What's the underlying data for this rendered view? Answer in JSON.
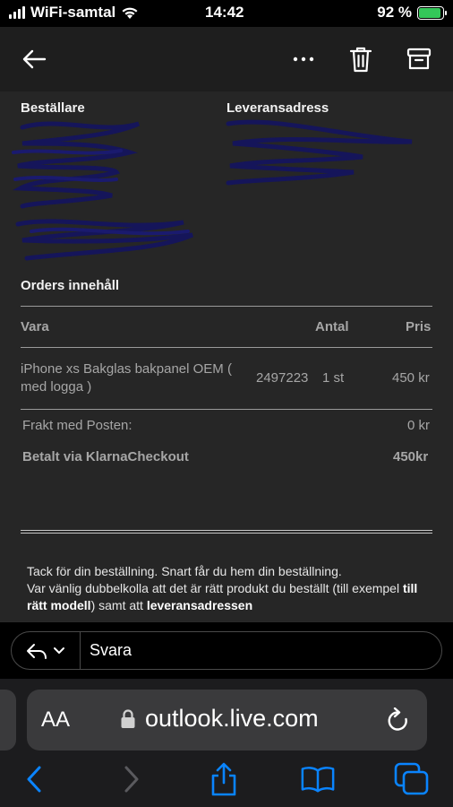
{
  "status_bar": {
    "carrier": "WiFi-samtal",
    "time": "14:42",
    "battery_percent": "92 %",
    "battery_level": 0.92,
    "battery_color": "#34c759"
  },
  "toolbar": {
    "back_icon": "arrow-left-icon",
    "more_icon": "more-dots-icon",
    "delete_icon": "trash-icon",
    "archive_icon": "archive-icon"
  },
  "email": {
    "buyer_heading": "Beställare",
    "delivery_heading": "Leveransadress",
    "order_contents_title": "Orders innehåll",
    "table": {
      "headers": {
        "item": "Vara",
        "quantity": "Antal",
        "price": "Pris"
      },
      "rows": [
        {
          "item": "iPhone xs Bakglas bakpanel OEM ( med logga )",
          "sku": "2497223",
          "quantity": "1 st",
          "price": "450 kr"
        }
      ]
    },
    "shipping_label": "Frakt med Posten:",
    "shipping_value": "0 kr",
    "paid_label": "Betalt via KlarnaCheckout",
    "paid_value": "450kr",
    "footer_line1": "Tack för din beställning. Snart får du hem din beställning.",
    "footer_line2_start": "Var vänlig dubbelkolla att det är rätt produkt du beställt (till exempel ",
    "footer_bold1": "till rätt modell",
    "footer_mid": ") samt att ",
    "footer_bold2": "leveransadressen"
  },
  "reply": {
    "action_icon": "reply-icon",
    "placeholder": "Svara"
  },
  "safari": {
    "text_size_label": "AA",
    "url": "outlook.live.com",
    "accent_color": "#0a84ff"
  }
}
